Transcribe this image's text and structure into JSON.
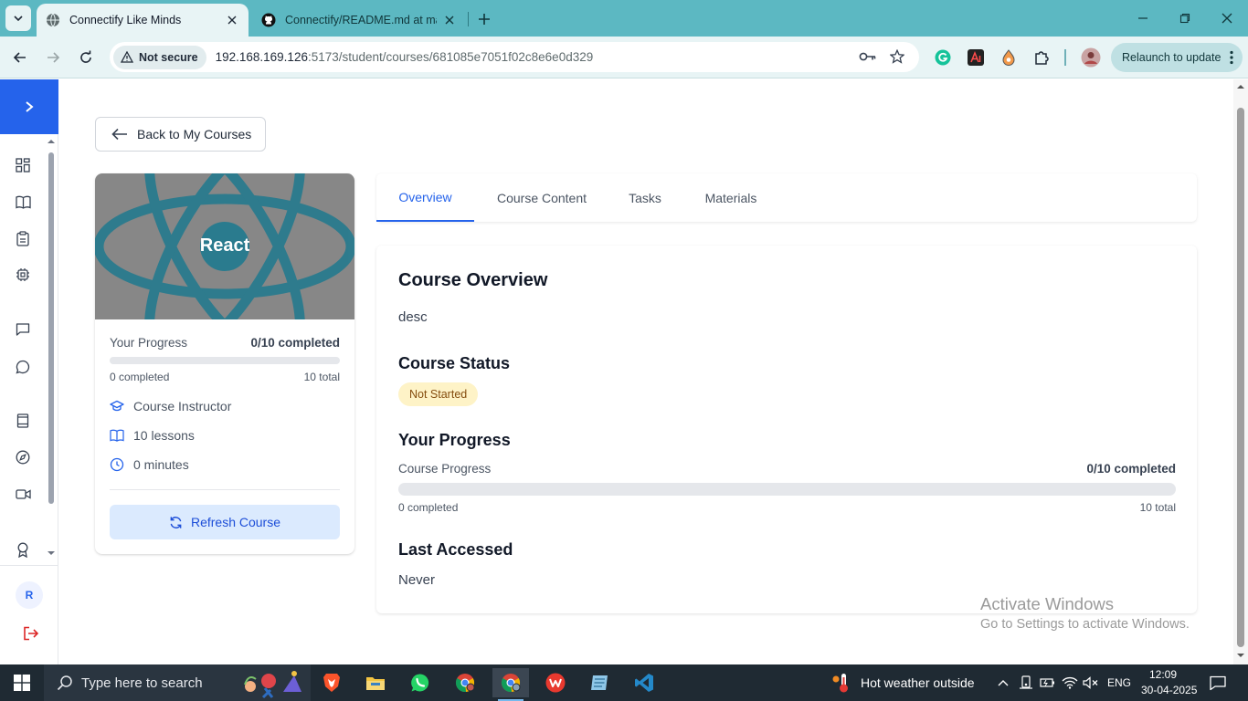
{
  "browser": {
    "tabs": [
      {
        "title": "Connectify Like Minds",
        "active": true
      },
      {
        "title": "Connectify/README.md at main",
        "active": false
      }
    ],
    "security_label": "Not secure",
    "url_host": "192.168.169.126",
    "url_rest": ":5173/student/courses/681085e7051f02c8e6e0d329",
    "relaunch_label": "Relaunch to update"
  },
  "back_button": {
    "label": "Back to My Courses"
  },
  "course": {
    "thumbnail_title": "React",
    "progress_label": "Your Progress",
    "progress_value": "0/10 completed",
    "progress_fraction": 0,
    "completed_label": "0 completed",
    "total_label": "10 total",
    "instructor": "Course Instructor",
    "lessons": "10 lessons",
    "duration": "0 minutes",
    "refresh_label": "Refresh Course"
  },
  "content_tabs": [
    {
      "label": "Overview",
      "active": true
    },
    {
      "label": "Course Content",
      "active": false
    },
    {
      "label": "Tasks",
      "active": false
    },
    {
      "label": "Materials",
      "active": false
    }
  ],
  "overview": {
    "heading": "Course Overview",
    "description": "desc",
    "status_heading": "Course Status",
    "status_badge": "Not Started",
    "progress_heading": "Your Progress",
    "course_progress_label": "Course Progress",
    "course_progress_value": "0/10 completed",
    "progress_fraction": 0,
    "completed_label": "0 completed",
    "total_label": "10 total",
    "last_accessed_heading": "Last Accessed",
    "last_accessed_value": "Never"
  },
  "sidebar": {
    "avatar_initial": "R"
  },
  "watermark": {
    "line1": "Activate Windows",
    "line2": "Go to Settings to activate Windows."
  },
  "taskbar": {
    "search_placeholder": "Type here to search",
    "weather": "Hot weather outside",
    "language": "ENG",
    "time": "12:09",
    "date": "30-04-2025"
  },
  "colors": {
    "accent": "#2563eb",
    "browser_frame": "#5cb8c2",
    "badge_bg": "#fef3c7"
  }
}
